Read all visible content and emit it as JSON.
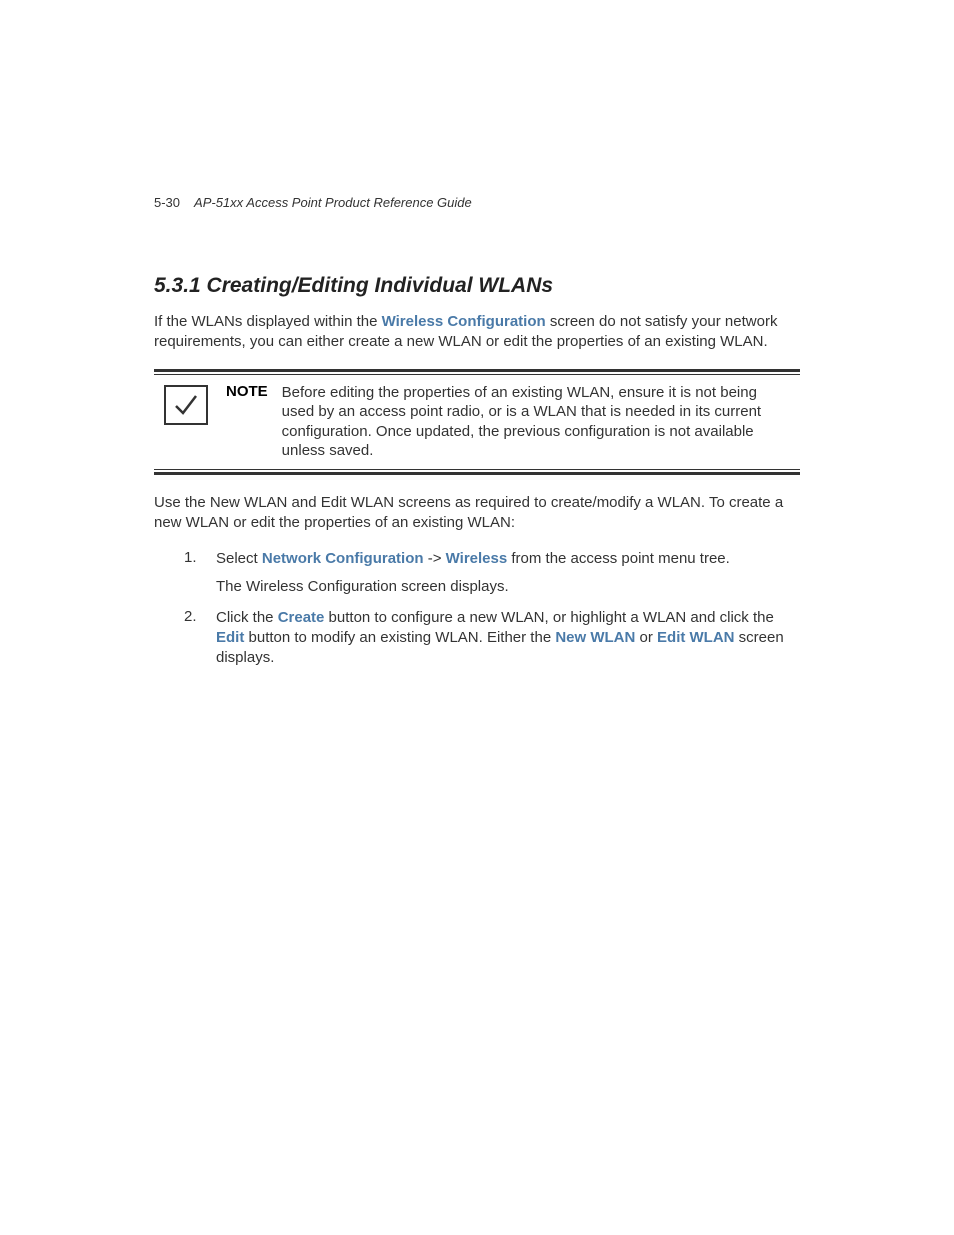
{
  "header": {
    "page_number": "5-30",
    "doc_title": "AP-51xx Access Point Product Reference Guide"
  },
  "section": {
    "heading": "5.3.1 Creating/Editing Individual WLANs",
    "intro_pre": "If the WLANs displayed within the ",
    "intro_link": "Wireless Configuration",
    "intro_post": " screen do not satisfy your network requirements, you can either create a new WLAN or edit the properties of an existing WLAN."
  },
  "note": {
    "label": "NOTE",
    "text": "Before editing the properties of an existing WLAN, ensure it is not being used by an access point radio, or is a WLAN that is needed in its current configuration. Once updated, the previous configuration is not available unless saved."
  },
  "post_note": "Use the New WLAN and Edit WLAN screens as required to create/modify a WLAN. To create a new WLAN or edit the properties of an existing WLAN:",
  "steps": {
    "s1": {
      "num": "1.",
      "pre": "Select ",
      "link1": "Network Configuration",
      "mid": " -> ",
      "link2": "Wireless",
      "post": " from the access point menu tree.",
      "sub": "The Wireless Configuration screen displays."
    },
    "s2": {
      "num": "2.",
      "pre": "Click the ",
      "link1": "Create",
      "mid1": " button to configure a new WLAN, or highlight a WLAN and click the ",
      "link2": "Edit",
      "mid2": " button to modify an existing WLAN. Either the ",
      "link3": "New WLAN",
      "mid3": " or ",
      "link4": "Edit WLAN",
      "post": " screen displays."
    }
  }
}
